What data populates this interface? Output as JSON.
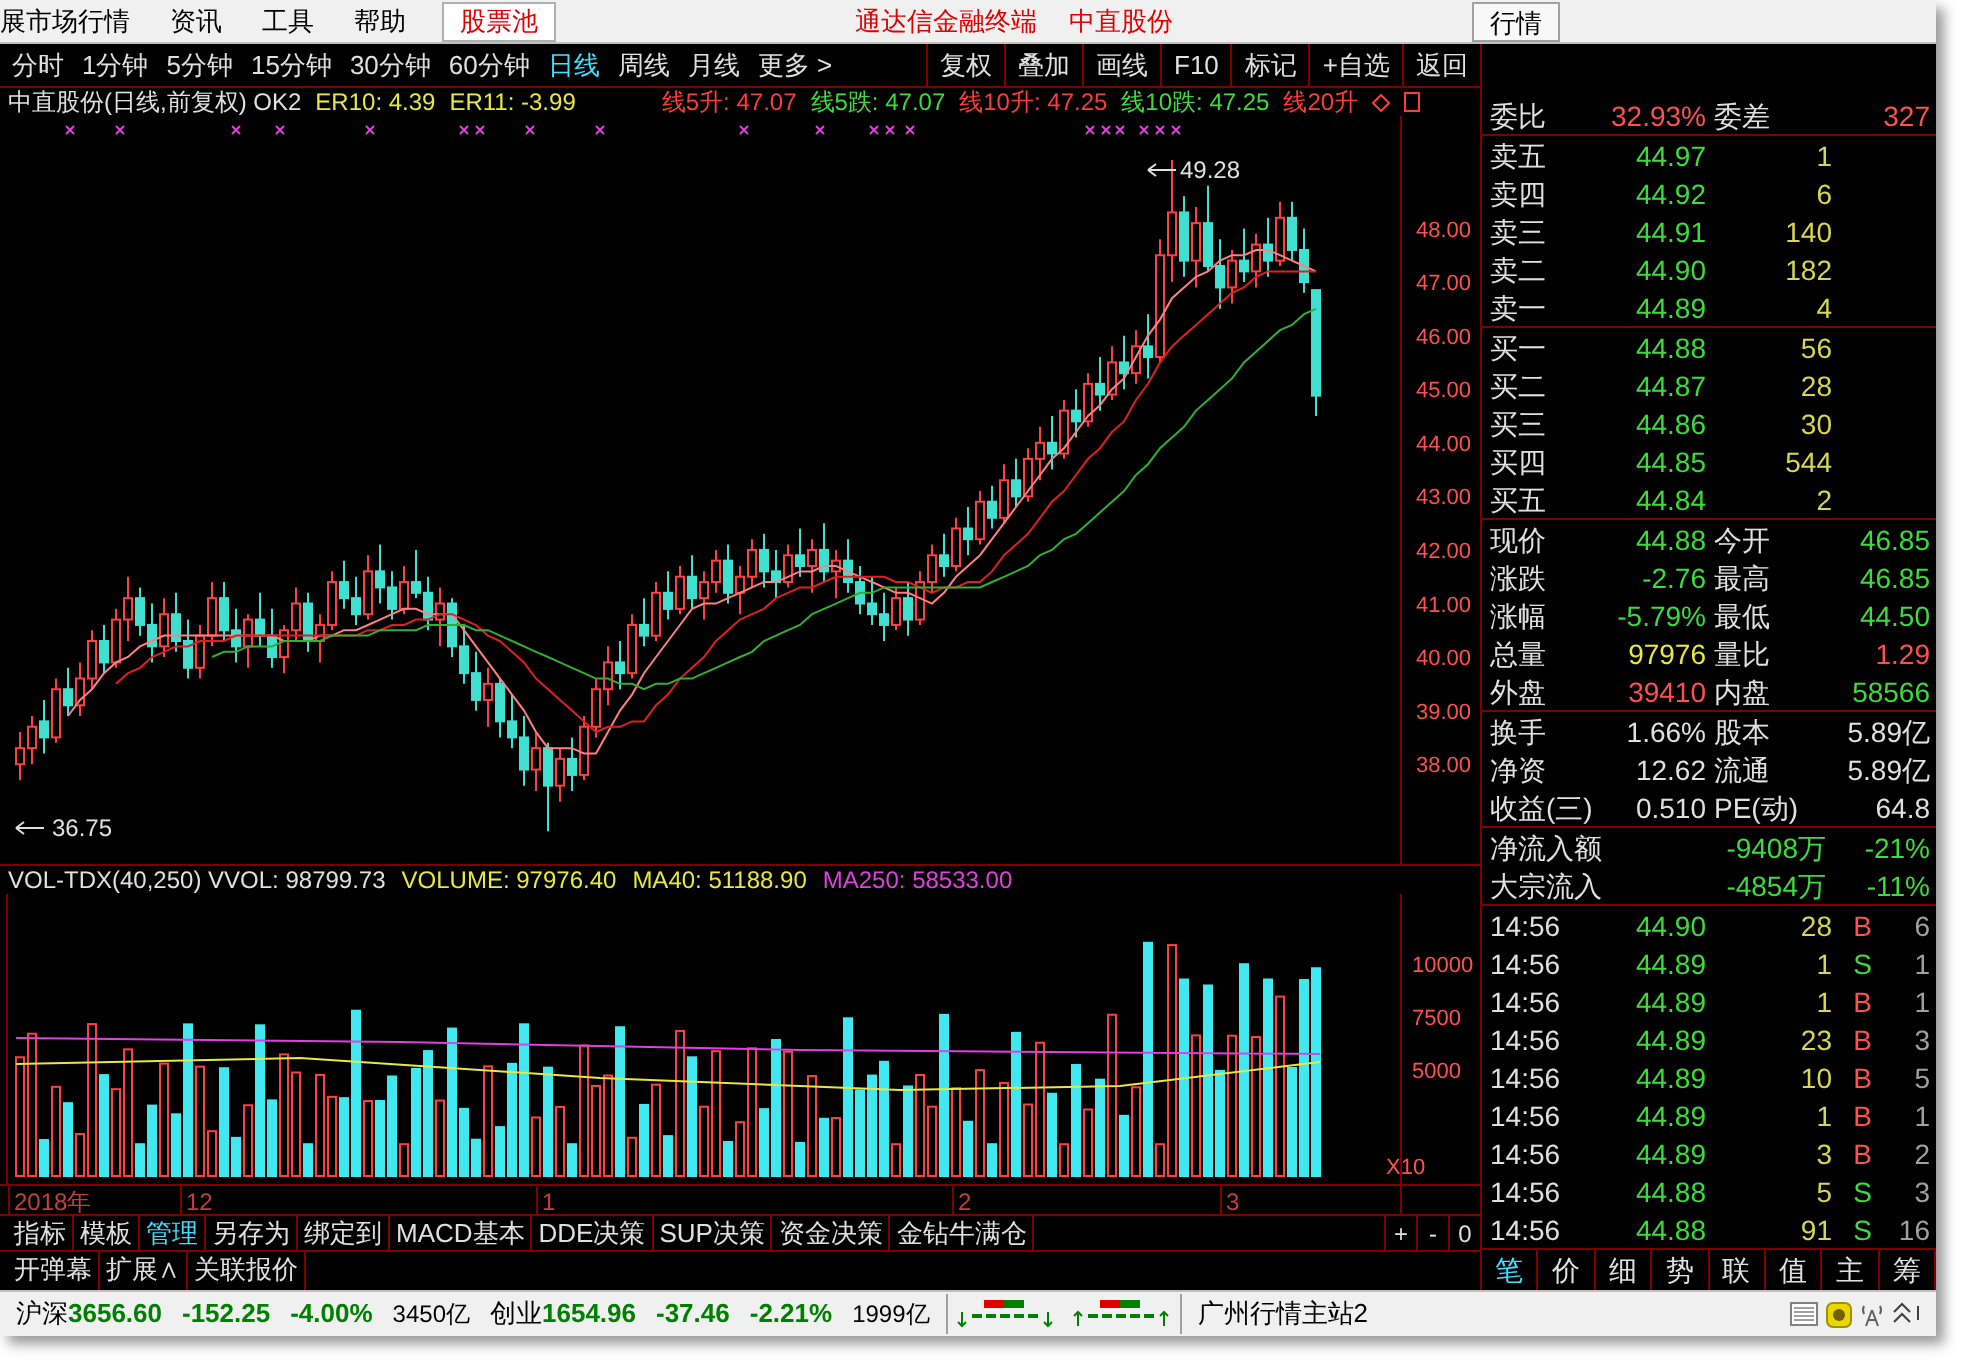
{
  "menu_bar": {
    "items": [
      {
        "label": "展市场行情",
        "selected": false
      },
      {
        "label": "资讯",
        "selected": false
      },
      {
        "label": "工具",
        "selected": false
      },
      {
        "label": "帮助",
        "selected": false
      },
      {
        "label": "股票池",
        "selected": true
      }
    ],
    "title": [
      "通达信金融终端",
      "中直股份"
    ],
    "right_button": "行情"
  },
  "toolbar": {
    "periods": [
      {
        "label": "分时",
        "selected": false
      },
      {
        "label": "1分钟",
        "selected": false
      },
      {
        "label": "5分钟",
        "selected": false
      },
      {
        "label": "15分钟",
        "selected": false
      },
      {
        "label": "30分钟",
        "selected": false
      },
      {
        "label": "60分钟",
        "selected": false
      },
      {
        "label": "日线",
        "selected": true
      },
      {
        "label": "周线",
        "selected": false
      },
      {
        "label": "月线",
        "selected": false
      },
      {
        "label": "更多 >",
        "selected": false
      }
    ],
    "buttons": [
      "复权",
      "叠加",
      "画线",
      "F10",
      "标记",
      "+自选",
      "返回"
    ]
  },
  "chart_header": {
    "title": "中直股份(日线,前复权) OK2",
    "indicators": [
      {
        "text": "ER10: 4.39",
        "color": "#e8e840"
      },
      {
        "text": "ER11: -3.99",
        "color": "#e8e840"
      },
      {
        "text": "线5升: 47.07",
        "color": "#ff3c3c"
      },
      {
        "text": "线5跌: 47.07",
        "color": "#3cdc3c"
      },
      {
        "text": "线10升: 47.25",
        "color": "#ff3c3c"
      },
      {
        "text": "线10跌: 47.25",
        "color": "#3cdc3c"
      },
      {
        "text": "线20升",
        "color": "#ff3c3c"
      }
    ]
  },
  "price_chart": {
    "high_label": "49.28",
    "low_label": "36.75",
    "chart_data": {
      "type": "candlestick",
      "ylim": [
        36.1,
        50.1
      ],
      "ohlc": [
        [
          38.0,
          38.6,
          37.7,
          38.3
        ],
        [
          38.3,
          38.9,
          38.0,
          38.7
        ],
        [
          38.8,
          39.2,
          38.2,
          38.5
        ],
        [
          38.5,
          39.6,
          38.4,
          39.4
        ],
        [
          39.4,
          39.8,
          38.9,
          39.1
        ],
        [
          39.1,
          39.9,
          38.9,
          39.6
        ],
        [
          39.6,
          40.5,
          39.4,
          40.3
        ],
        [
          40.3,
          40.6,
          39.7,
          39.9
        ],
        [
          39.9,
          40.9,
          39.8,
          40.7
        ],
        [
          40.7,
          41.5,
          40.3,
          41.1
        ],
        [
          41.1,
          41.3,
          40.4,
          40.6
        ],
        [
          40.6,
          41.0,
          39.9,
          40.2
        ],
        [
          40.2,
          41.1,
          40.0,
          40.8
        ],
        [
          40.8,
          41.2,
          40.1,
          40.3
        ],
        [
          40.3,
          40.7,
          39.6,
          39.8
        ],
        [
          39.8,
          40.6,
          39.6,
          40.4
        ],
        [
          40.4,
          41.4,
          40.2,
          41.1
        ],
        [
          41.1,
          41.4,
          40.3,
          40.5
        ],
        [
          40.5,
          40.9,
          39.9,
          40.2
        ],
        [
          40.2,
          40.8,
          39.8,
          40.7
        ],
        [
          40.7,
          41.2,
          40.2,
          40.4
        ],
        [
          40.4,
          40.9,
          39.8,
          40.0
        ],
        [
          40.0,
          40.6,
          39.7,
          40.5
        ],
        [
          40.5,
          41.3,
          40.3,
          41.0
        ],
        [
          41.0,
          41.2,
          40.1,
          40.3
        ],
        [
          40.3,
          40.8,
          39.9,
          40.6
        ],
        [
          40.6,
          41.6,
          40.5,
          41.4
        ],
        [
          41.4,
          41.8,
          40.9,
          41.1
        ],
        [
          41.1,
          41.5,
          40.6,
          40.8
        ],
        [
          40.8,
          41.9,
          40.7,
          41.6
        ],
        [
          41.6,
          42.1,
          41.0,
          41.3
        ],
        [
          41.3,
          41.6,
          40.7,
          40.9
        ],
        [
          40.9,
          41.7,
          40.8,
          41.4
        ],
        [
          41.4,
          42.0,
          41.1,
          41.2
        ],
        [
          41.2,
          41.5,
          40.5,
          40.7
        ],
        [
          40.7,
          41.3,
          40.2,
          41.0
        ],
        [
          41.0,
          41.1,
          40.0,
          40.2
        ],
        [
          40.2,
          40.6,
          39.5,
          39.7
        ],
        [
          39.7,
          40.1,
          39.0,
          39.2
        ],
        [
          39.2,
          39.8,
          38.7,
          39.5
        ],
        [
          39.5,
          39.6,
          38.5,
          38.8
        ],
        [
          38.8,
          39.3,
          38.3,
          38.5
        ],
        [
          38.5,
          38.9,
          37.6,
          37.9
        ],
        [
          37.9,
          38.6,
          37.5,
          38.3
        ],
        [
          38.3,
          38.4,
          36.75,
          37.6
        ],
        [
          37.6,
          38.3,
          37.3,
          38.1
        ],
        [
          38.1,
          38.5,
          37.5,
          37.8
        ],
        [
          37.8,
          38.9,
          37.7,
          38.7
        ],
        [
          38.7,
          39.6,
          38.5,
          39.4
        ],
        [
          39.4,
          40.2,
          39.1,
          39.9
        ],
        [
          39.9,
          40.3,
          39.4,
          39.7
        ],
        [
          39.7,
          40.8,
          39.6,
          40.6
        ],
        [
          40.6,
          41.1,
          40.2,
          40.4
        ],
        [
          40.4,
          41.4,
          40.3,
          41.2
        ],
        [
          41.2,
          41.6,
          40.7,
          40.9
        ],
        [
          40.9,
          41.7,
          40.8,
          41.5
        ],
        [
          41.5,
          41.9,
          40.9,
          41.1
        ],
        [
          41.1,
          41.6,
          40.7,
          41.4
        ],
        [
          41.4,
          42.0,
          41.2,
          41.8
        ],
        [
          41.8,
          42.1,
          41.0,
          41.2
        ],
        [
          41.2,
          41.7,
          40.8,
          41.5
        ],
        [
          41.5,
          42.2,
          41.3,
          42.0
        ],
        [
          42.0,
          42.3,
          41.3,
          41.6
        ],
        [
          41.6,
          42.0,
          41.1,
          41.4
        ],
        [
          41.4,
          42.1,
          41.3,
          41.9
        ],
        [
          41.9,
          42.4,
          41.5,
          41.7
        ],
        [
          41.7,
          42.2,
          41.2,
          42.0
        ],
        [
          42.0,
          42.5,
          41.4,
          41.6
        ],
        [
          41.6,
          42.0,
          41.1,
          41.8
        ],
        [
          41.8,
          42.2,
          41.2,
          41.4
        ],
        [
          41.4,
          41.7,
          40.8,
          41.0
        ],
        [
          41.0,
          41.5,
          40.6,
          40.8
        ],
        [
          40.8,
          41.2,
          40.3,
          40.6
        ],
        [
          40.6,
          41.3,
          40.5,
          41.1
        ],
        [
          41.1,
          41.4,
          40.4,
          40.7
        ],
        [
          40.7,
          41.6,
          40.6,
          41.4
        ],
        [
          41.4,
          42.1,
          41.2,
          41.9
        ],
        [
          41.9,
          42.3,
          41.5,
          41.7
        ],
        [
          41.7,
          42.6,
          41.6,
          42.4
        ],
        [
          42.4,
          42.8,
          41.9,
          42.2
        ],
        [
          42.2,
          43.1,
          42.1,
          42.9
        ],
        [
          42.9,
          43.2,
          42.4,
          42.6
        ],
        [
          42.6,
          43.6,
          42.5,
          43.3
        ],
        [
          43.3,
          43.7,
          42.8,
          43.0
        ],
        [
          43.0,
          43.9,
          42.9,
          43.7
        ],
        [
          43.7,
          44.3,
          43.3,
          44.0
        ],
        [
          44.0,
          44.5,
          43.5,
          43.8
        ],
        [
          43.8,
          44.8,
          43.7,
          44.6
        ],
        [
          44.6,
          45.0,
          44.1,
          44.4
        ],
        [
          44.4,
          45.3,
          44.3,
          45.1
        ],
        [
          45.1,
          45.6,
          44.6,
          44.9
        ],
        [
          44.9,
          45.8,
          44.8,
          45.5
        ],
        [
          45.5,
          46.0,
          45.0,
          45.3
        ],
        [
          45.3,
          46.1,
          45.1,
          45.8
        ],
        [
          45.8,
          46.4,
          45.2,
          45.6
        ],
        [
          45.6,
          47.8,
          45.5,
          47.5
        ],
        [
          47.5,
          49.28,
          47.0,
          48.3
        ],
        [
          48.3,
          48.6,
          47.1,
          47.4
        ],
        [
          47.4,
          48.4,
          46.9,
          48.1
        ],
        [
          48.1,
          48.8,
          47.2,
          47.3
        ],
        [
          47.3,
          47.8,
          46.5,
          46.9
        ],
        [
          46.9,
          47.6,
          46.6,
          47.4
        ],
        [
          47.4,
          48.0,
          47.0,
          47.2
        ],
        [
          47.2,
          47.9,
          46.9,
          47.7
        ],
        [
          47.7,
          48.2,
          47.1,
          47.4
        ],
        [
          47.4,
          48.5,
          47.3,
          48.2
        ],
        [
          48.2,
          48.5,
          47.4,
          47.6
        ],
        [
          47.6,
          48.0,
          46.8,
          47.0
        ],
        [
          46.85,
          46.85,
          44.5,
          44.88
        ]
      ],
      "yticks": [
        {
          "value": 48,
          "label": "48.00"
        },
        {
          "value": 47,
          "label": "47.00"
        },
        {
          "value": 46,
          "label": "46.00"
        },
        {
          "value": 45,
          "label": "45.00"
        },
        {
          "value": 44,
          "label": "44.00"
        },
        {
          "value": 43,
          "label": "43.00"
        },
        {
          "value": 42,
          "label": "42.00"
        },
        {
          "value": 41,
          "label": "41.00"
        },
        {
          "value": 40,
          "label": "40.00"
        },
        {
          "value": 39,
          "label": "39.00"
        },
        {
          "value": 38,
          "label": "38.00"
        }
      ],
      "series": [
        {
          "type": "line",
          "color": "#ff8080",
          "values": [
            null,
            null,
            null,
            null,
            38.9,
            39.2,
            39.4,
            39.7,
            39.9,
            40.0,
            40.2,
            40.3,
            40.4,
            40.4,
            40.4,
            40.4,
            40.4,
            40.4,
            40.4,
            40.4,
            40.4,
            40.4,
            40.3,
            40.3,
            40.3,
            40.4,
            40.4,
            40.5,
            40.5,
            40.6,
            40.7,
            40.8,
            40.9,
            40.9,
            40.8,
            40.8,
            40.8,
            40.5,
            40.2,
            39.9,
            39.6,
            39.3,
            39.0,
            38.6,
            38.3,
            38.3,
            38.3,
            38.2,
            38.2,
            38.6,
            39.0,
            39.3,
            39.7,
            40.0,
            40.3,
            40.6,
            40.9,
            41.0,
            41.0,
            41.1,
            41.2,
            41.3,
            41.4,
            41.4,
            41.5,
            41.6,
            41.6,
            41.7,
            41.7,
            41.6,
            41.5,
            41.4,
            41.3,
            41.2,
            41.2,
            41.1,
            41.0,
            41.2,
            41.5,
            41.7,
            41.9,
            42.2,
            42.5,
            42.8,
            43.1,
            43.4,
            43.7,
            43.9,
            44.2,
            44.5,
            44.7,
            45.0,
            45.2,
            45.6,
            46.0,
            46.3,
            46.7,
            46.9,
            47.1,
            47.2,
            47.4,
            47.5,
            47.5,
            47.6,
            47.6,
            47.5,
            47.4,
            47.3,
            47.2
          ]
        },
        {
          "type": "line",
          "color": "#e02020",
          "values": [
            null,
            null,
            null,
            null,
            null,
            null,
            null,
            null,
            39.5,
            39.7,
            39.8,
            40.0,
            40.1,
            40.2,
            40.2,
            40.3,
            40.3,
            40.3,
            40.4,
            40.4,
            40.4,
            40.4,
            40.4,
            40.4,
            40.4,
            40.4,
            40.4,
            40.4,
            40.4,
            40.5,
            40.5,
            40.6,
            40.6,
            40.7,
            40.7,
            40.8,
            40.8,
            40.7,
            40.6,
            40.4,
            40.3,
            40.1,
            39.9,
            39.6,
            39.4,
            39.2,
            39.0,
            38.8,
            38.6,
            38.7,
            38.7,
            38.8,
            38.8,
            39.1,
            39.3,
            39.6,
            39.8,
            40.0,
            40.3,
            40.5,
            40.7,
            40.8,
            40.9,
            41.1,
            41.2,
            41.3,
            41.3,
            41.4,
            41.5,
            41.5,
            41.5,
            41.5,
            41.5,
            41.4,
            41.4,
            41.3,
            41.2,
            41.3,
            41.3,
            41.4,
            41.4,
            41.6,
            41.9,
            42.1,
            42.3,
            42.6,
            42.9,
            43.1,
            43.4,
            43.7,
            43.9,
            44.2,
            44.4,
            44.8,
            45.1,
            45.5,
            45.8,
            46.0,
            46.2,
            46.4,
            46.6,
            46.8,
            46.9,
            47.1,
            47.2,
            47.2,
            47.2,
            47.2,
            47.2
          ]
        },
        {
          "type": "line",
          "color": "#30b030",
          "values": [
            null,
            null,
            null,
            null,
            null,
            null,
            null,
            null,
            null,
            null,
            null,
            null,
            null,
            null,
            null,
            null,
            40.0,
            40.1,
            40.1,
            40.2,
            40.2,
            40.2,
            40.3,
            40.3,
            40.3,
            40.3,
            40.4,
            40.4,
            40.4,
            40.4,
            40.5,
            40.5,
            40.5,
            40.5,
            40.6,
            40.6,
            40.6,
            40.6,
            40.5,
            40.5,
            40.4,
            40.3,
            40.2,
            40.1,
            40.0,
            39.9,
            39.8,
            39.7,
            39.6,
            39.6,
            39.5,
            39.5,
            39.4,
            39.5,
            39.5,
            39.6,
            39.6,
            39.7,
            39.8,
            39.9,
            40.0,
            40.1,
            40.3,
            40.4,
            40.5,
            40.6,
            40.8,
            40.9,
            41.0,
            41.1,
            41.2,
            41.2,
            41.3,
            41.3,
            41.3,
            41.3,
            41.3,
            41.3,
            41.3,
            41.3,
            41.3,
            41.4,
            41.5,
            41.6,
            41.7,
            41.9,
            42.0,
            42.2,
            42.3,
            42.5,
            42.7,
            42.9,
            43.1,
            43.4,
            43.6,
            43.9,
            44.1,
            44.3,
            44.6,
            44.8,
            45.0,
            45.2,
            45.5,
            45.7,
            45.9,
            46.1,
            46.2,
            46.4,
            46.5
          ]
        }
      ]
    }
  },
  "volume_header": [
    {
      "text": "VOL-TDX(40,250) VVOL: 98799.73",
      "color": "#e0e0e0"
    },
    {
      "text": "VOLUME: 97976.40",
      "color": "#e8e840"
    },
    {
      "text": "MA40: 51188.90",
      "color": "#e8e840"
    },
    {
      "text": "MA250: 58533.00",
      "color": "#e040e0"
    }
  ],
  "volume_chart": {
    "axis_labels": [
      "10000",
      "7500",
      "5000"
    ],
    "unit": "X10"
  },
  "date_axis": [
    "2018年",
    "12",
    "1",
    "2",
    "3"
  ],
  "tabs_row1": [
    {
      "label": "指标",
      "selected": false
    },
    {
      "label": "模板",
      "selected": false
    },
    {
      "label": "管理",
      "selected": true
    },
    {
      "label": "另存为",
      "selected": false
    },
    {
      "label": "绑定到",
      "selected": false
    },
    {
      "label": "MACD基本",
      "selected": false
    },
    {
      "label": "DDE决策",
      "selected": false
    },
    {
      "label": "SUP决策",
      "selected": false
    },
    {
      "label": "资金决策",
      "selected": false
    },
    {
      "label": "金钻牛满仓",
      "selected": false
    }
  ],
  "zoom_buttons": [
    "+",
    "-",
    "0"
  ],
  "tabs_row2": [
    "开弹幕",
    "扩展∧",
    "关联报价"
  ],
  "quote": {
    "order_ratio": {
      "label": "委比",
      "value": "32.93%",
      "label2": "委差",
      "value2": "327"
    },
    "asks": [
      {
        "label": "卖五",
        "price": "44.97",
        "volume": "1"
      },
      {
        "label": "卖四",
        "price": "44.92",
        "volume": "6"
      },
      {
        "label": "卖三",
        "price": "44.91",
        "volume": "140"
      },
      {
        "label": "卖二",
        "price": "44.90",
        "volume": "182"
      },
      {
        "label": "卖一",
        "price": "44.89",
        "volume": "4"
      }
    ],
    "bids": [
      {
        "label": "买一",
        "price": "44.88",
        "volume": "56"
      },
      {
        "label": "买二",
        "price": "44.87",
        "volume": "28"
      },
      {
        "label": "买三",
        "price": "44.86",
        "volume": "30"
      },
      {
        "label": "买四",
        "price": "44.85",
        "volume": "544"
      },
      {
        "label": "买五",
        "price": "44.84",
        "volume": "2"
      }
    ],
    "stats": [
      {
        "label": "现价",
        "value": "44.88",
        "color": "#3cdc3c"
      },
      {
        "label": "今开",
        "value": "46.85",
        "color": "#3cdc3c"
      },
      {
        "label": "涨跌",
        "value": "-2.76",
        "color": "#3cdc3c"
      },
      {
        "label": "最高",
        "value": "46.85",
        "color": "#3cdc3c"
      },
      {
        "label": "涨幅",
        "value": "-5.79%",
        "color": "#3cdc3c"
      },
      {
        "label": "最低",
        "value": "44.50",
        "color": "#3cdc3c"
      },
      {
        "label": "总量",
        "value": "97976",
        "color": "#e8e840"
      },
      {
        "label": "量比",
        "value": "1.29",
        "color": "#ff5050"
      },
      {
        "label": "外盘",
        "value": "39410",
        "color": "#ff5050"
      },
      {
        "label": "内盘",
        "value": "58566",
        "color": "#3cdc3c"
      }
    ],
    "fundamentals": [
      {
        "label": "换手",
        "value": "1.66%",
        "label2": "股本",
        "value2": "5.89亿"
      },
      {
        "label": "净资",
        "value": "12.62",
        "label2": "流通",
        "value2": "5.89亿"
      },
      {
        "label": "收益(三)",
        "value": "0.510",
        "label2": "PE(动)",
        "value2": "64.8"
      }
    ],
    "flows": [
      {
        "label": "净流入额",
        "amount": "-9408万",
        "percent": "-21%"
      },
      {
        "label": "大宗流入",
        "amount": "-4854万",
        "percent": "-11%"
      }
    ],
    "trades": [
      {
        "time": "14:56",
        "price": "44.90",
        "volume": "28",
        "side": "B",
        "color": "#ff5050",
        "count": "6"
      },
      {
        "time": "14:56",
        "price": "44.89",
        "volume": "1",
        "side": "S",
        "color": "#3cdc3c",
        "count": "1"
      },
      {
        "time": "14:56",
        "price": "44.89",
        "volume": "1",
        "side": "B",
        "color": "#ff5050",
        "count": "1"
      },
      {
        "time": "14:56",
        "price": "44.89",
        "volume": "23",
        "side": "B",
        "color": "#ff5050",
        "count": "3"
      },
      {
        "time": "14:56",
        "price": "44.89",
        "volume": "10",
        "side": "B",
        "color": "#ff5050",
        "count": "5"
      },
      {
        "time": "14:56",
        "price": "44.89",
        "volume": "1",
        "side": "B",
        "color": "#ff5050",
        "count": "1"
      },
      {
        "time": "14:56",
        "price": "44.89",
        "volume": "3",
        "side": "B",
        "color": "#ff5050",
        "count": "2"
      },
      {
        "time": "14:56",
        "price": "44.88",
        "volume": "5",
        "side": "S",
        "color": "#3cdc3c",
        "count": "3"
      },
      {
        "time": "14:56",
        "price": "44.88",
        "volume": "91",
        "side": "S",
        "color": "#3cdc3c",
        "count": "16"
      }
    ],
    "tabs": [
      {
        "label": "笔",
        "selected": true
      },
      {
        "label": "价",
        "selected": false
      },
      {
        "label": "细",
        "selected": false
      },
      {
        "label": "势",
        "selected": false
      },
      {
        "label": "联",
        "selected": false
      },
      {
        "label": "值",
        "selected": false
      },
      {
        "label": "主",
        "selected": false
      },
      {
        "label": "筹",
        "selected": false
      }
    ]
  },
  "status_bar": {
    "indices": [
      {
        "name": "沪深",
        "value": "3656.60",
        "change": "-152.25",
        "percent": "-4.00%",
        "turnover": "3450亿"
      },
      {
        "name": "创业",
        "value": "1654.96",
        "change": "-37.46",
        "percent": "-2.21%",
        "turnover": "1999亿"
      }
    ],
    "server": "广州行情主站2"
  }
}
